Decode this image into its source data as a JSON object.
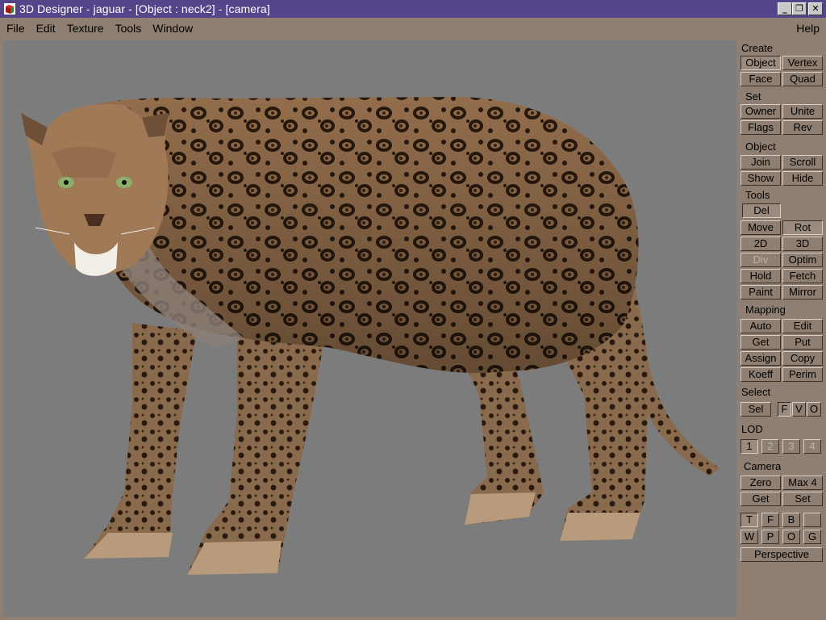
{
  "window": {
    "title": "3D Designer - jaguar - [Object : neck2] - [camera]",
    "controls": {
      "minimize": "_",
      "restore": "❐",
      "close": "✕"
    }
  },
  "menu": {
    "items": [
      "File",
      "Edit",
      "Texture",
      "Tools",
      "Window"
    ],
    "help": "Help"
  },
  "panel": {
    "create": {
      "label": "Create",
      "object": "Object",
      "vertex": "Vertex",
      "face": "Face",
      "quad": "Quad"
    },
    "set": {
      "label": "Set",
      "owner": "Owner",
      "unite": "Unite",
      "flags": "Flags",
      "rev": "Rev"
    },
    "object": {
      "label": "Object",
      "join": "Join",
      "scroll": "Scroll",
      "show": "Show",
      "hide": "Hide"
    },
    "tools": {
      "label": "Tools",
      "del": "Del",
      "move": "Move",
      "rot": "Rot",
      "d2": "2D",
      "d3": "3D",
      "div": "Div",
      "optim": "Optim",
      "hold": "Hold",
      "fetch": "Fetch",
      "paint": "Paint",
      "mirror": "Mirror"
    },
    "mapping": {
      "label": "Mapping",
      "auto": "Auto",
      "edit": "Edit",
      "get": "Get",
      "put": "Put",
      "assign": "Assign",
      "copy": "Copy",
      "koeff": "Koeff",
      "perim": "Perim"
    },
    "select": {
      "label": "Select",
      "sel": "Sel",
      "f": "F",
      "v": "V",
      "o": "O"
    },
    "lod": {
      "label": "LOD",
      "l1": "1",
      "l2": "2",
      "l3": "3",
      "l4": "4"
    },
    "camera": {
      "label": "Camera",
      "zero": "Zero",
      "max4": "Max 4",
      "get": "Get",
      "set": "Set"
    },
    "views": {
      "t": "T",
      "f": "F",
      "b": "B",
      "blank": "",
      "w": "W",
      "p": "P",
      "o": "O",
      "g": "G",
      "perspective": "Perspective"
    }
  },
  "colors": {
    "titlebar": "#54458a",
    "chrome": "#8e7f72",
    "viewport": "#7c7c7c"
  }
}
